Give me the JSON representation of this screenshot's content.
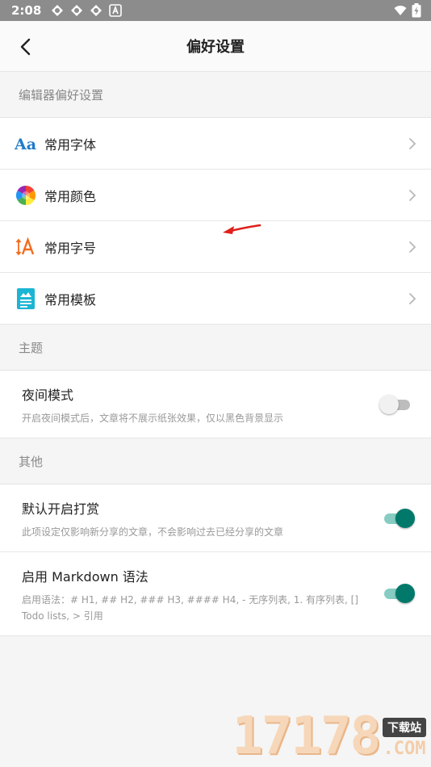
{
  "status_bar": {
    "time": "2:08",
    "left_icons": [
      "notification-icon",
      "notification-icon",
      "notification-icon",
      "app-a-icon"
    ],
    "right_icons": [
      "wifi-icon",
      "battery-icon"
    ]
  },
  "header": {
    "title": "偏好设置",
    "back_icon": "back-arrow-icon"
  },
  "sections": {
    "editor": {
      "title": "编辑器偏好设置",
      "items": [
        {
          "label": "常用字体",
          "icon": "font-icon"
        },
        {
          "label": "常用颜色",
          "icon": "color-wheel-icon"
        },
        {
          "label": "常用字号",
          "icon": "font-size-icon"
        },
        {
          "label": "常用模板",
          "icon": "template-icon"
        }
      ]
    },
    "theme": {
      "title": "主题",
      "night_mode": {
        "title": "夜间模式",
        "desc": "开启夜间模式后，文章将不展示纸张效果，仅以黑色背景显示",
        "enabled": false
      }
    },
    "other": {
      "title": "其他",
      "reward": {
        "title": "默认开启打赏",
        "desc": "此项设定仅影响新分享的文章，不会影响过去已经分享的文章",
        "enabled": true
      },
      "markdown": {
        "title": "启用 Markdown 语法",
        "desc": "启用语法：# H1, ## H2, ### H3, #### H4, - 无序列表, 1. 有序列表, [] Todo lists, > 引用",
        "enabled": true
      }
    }
  },
  "colors": {
    "accent": "#00796b",
    "accent_track": "#86ccc2",
    "font_icon": "#1f7ac9",
    "size_icon": "#f26b1d",
    "template_icon": "#1cb5d4"
  },
  "watermark": {
    "number": "17178",
    "badge": "下载站",
    "suffix": ".COM"
  }
}
